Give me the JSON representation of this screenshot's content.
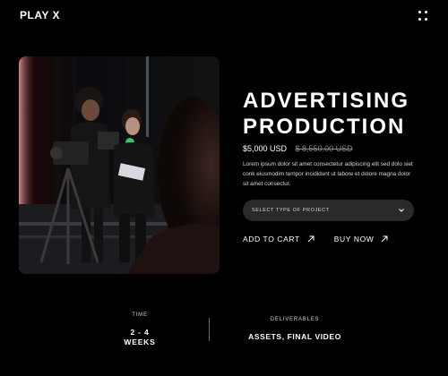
{
  "header": {
    "brand": "PLAY X",
    "menu_icon": "grid-menu-icon"
  },
  "product": {
    "image_icon": "production-photo",
    "title_line1": "ADVERTISING",
    "title_line2": "PRODUCTION",
    "price": "$5,000 USD",
    "old_price": "$ 8,550.00 USD",
    "description": "Lorem ipsum dolor sit amet consectetur adipiscing elit sed dolo siet conk eiusmodim tempor incididunt ut labore et dolore magna dolor sit amet consectur.",
    "select_placeholder": "SELECT TYPE OF PROJECT",
    "add_to_cart": "ADD TO CART",
    "buy_now": "BUY NOW"
  },
  "details": {
    "time_label": "TIME",
    "time_value_line1": "2 - 4",
    "time_value_line2": "WEEKS",
    "deliverables_label": "DELIVERABLES",
    "deliverables_value": "ASSETS, FINAL VIDEO"
  },
  "colors": {
    "background": "#000000",
    "select_background": "#2a2a2a",
    "muted_text": "#8a8a8a"
  }
}
